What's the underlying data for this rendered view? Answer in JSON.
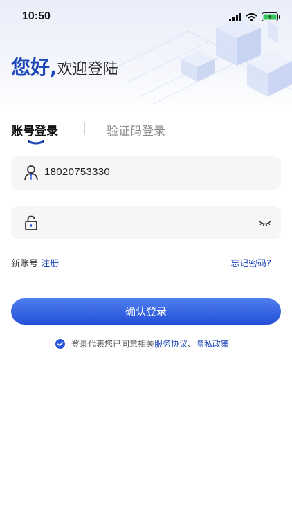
{
  "status_bar": {
    "time": "10:50"
  },
  "greeting": {
    "main": "您好,",
    "sub": "欢迎登陆"
  },
  "tabs": {
    "account": "账号登录",
    "sms": "验证码登录"
  },
  "fields": {
    "phone": "18020753330",
    "password": ""
  },
  "links": {
    "new_account": "新账号",
    "register": "注册",
    "forgot": "忘记密码?"
  },
  "button": {
    "confirm": "确认登录"
  },
  "agreement": {
    "prefix": "登录代表您已同意相关",
    "service": "服务协议",
    "separator": "、",
    "privacy": "隐私政策"
  },
  "colors": {
    "accent": "#1d47b8",
    "button_top": "#4f7ef0",
    "button_bottom": "#2450d6",
    "field_bg": "#f6f6f7"
  },
  "icons": [
    "signal-icon",
    "wifi-icon",
    "battery-icon",
    "user-icon",
    "lock-icon",
    "eye-closed-icon",
    "checkbox-icon"
  ]
}
